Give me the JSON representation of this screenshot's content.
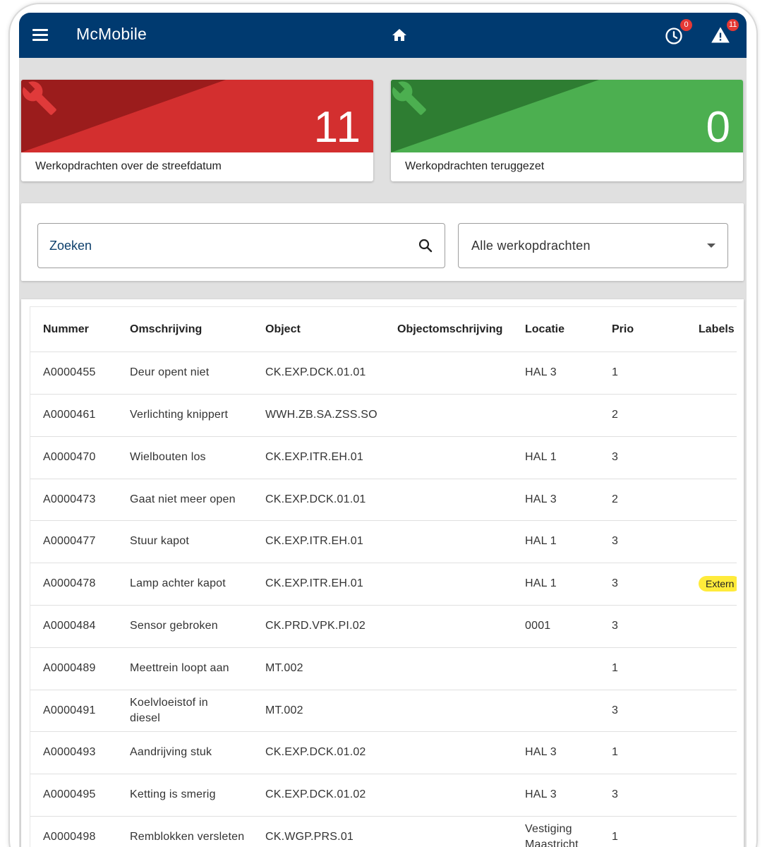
{
  "app": {
    "title": "McMobile",
    "clock_badge": "0",
    "alert_badge": "11"
  },
  "cards": [
    {
      "count": "11",
      "label": "Werkopdrachten over de streefdatum",
      "color": "#d32f2f",
      "dark_color": "#9b1c1c"
    },
    {
      "count": "0",
      "label": "Werkopdrachten teruggezet",
      "color": "#4caf50",
      "dark_color": "#2e7d32"
    }
  ],
  "filters": {
    "search_placeholder": "Zoeken",
    "select_value": "Alle werkopdrachten"
  },
  "table": {
    "headers": {
      "nummer": "Nummer",
      "omschrijving": "Omschrijving",
      "object": "Object",
      "objectomschrijving": "Objectomschrijving",
      "locatie": "Locatie",
      "prio": "Prio",
      "labels": "Labels"
    },
    "rows": [
      {
        "nummer": "A0000455",
        "omschrijving": "Deur opent niet",
        "object": "CK.EXP.DCK.01.01",
        "objectomschrijving": "",
        "locatie": "HAL 3",
        "prio": "1",
        "labels": ""
      },
      {
        "nummer": "A0000461",
        "omschrijving": "Verlichting knippert",
        "object": "WWH.ZB.SA.ZSS.SO",
        "objectomschrijving": "",
        "locatie": "",
        "prio": "2",
        "labels": ""
      },
      {
        "nummer": "A0000470",
        "omschrijving": "Wielbouten los",
        "object": "CK.EXP.ITR.EH.01",
        "objectomschrijving": "",
        "locatie": "HAL 1",
        "prio": "3",
        "labels": ""
      },
      {
        "nummer": "A0000473",
        "omschrijving": "Gaat niet meer open",
        "object": "CK.EXP.DCK.01.01",
        "objectomschrijving": "",
        "locatie": "HAL 3",
        "prio": "2",
        "labels": ""
      },
      {
        "nummer": "A0000477",
        "omschrijving": "Stuur kapot",
        "object": "CK.EXP.ITR.EH.01",
        "objectomschrijving": "",
        "locatie": "HAL 1",
        "prio": "3",
        "labels": ""
      },
      {
        "nummer": "A0000478",
        "omschrijving": "Lamp achter kapot",
        "object": "CK.EXP.ITR.EH.01",
        "objectomschrijving": "",
        "locatie": "HAL 1",
        "prio": "3",
        "labels": "Extern"
      },
      {
        "nummer": "A0000484",
        "omschrijving": "Sensor gebroken",
        "object": "CK.PRD.VPK.PI.02",
        "objectomschrijving": "",
        "locatie": "0001",
        "prio": "3",
        "labels": ""
      },
      {
        "nummer": "A0000489",
        "omschrijving": "Meettrein loopt aan",
        "object": "MT.002",
        "objectomschrijving": "",
        "locatie": "",
        "prio": "1",
        "labels": ""
      },
      {
        "nummer": "A0000491",
        "omschrijving": "Koelvloeistof in diesel",
        "object": "MT.002",
        "objectomschrijving": "",
        "locatie": "",
        "prio": "3",
        "labels": ""
      },
      {
        "nummer": "A0000493",
        "omschrijving": "Aandrijving stuk",
        "object": "CK.EXP.DCK.01.02",
        "objectomschrijving": "",
        "locatie": "HAL 3",
        "prio": "1",
        "labels": ""
      },
      {
        "nummer": "A0000495",
        "omschrijving": "Ketting is smerig",
        "object": "CK.EXP.DCK.01.02",
        "objectomschrijving": "",
        "locatie": "HAL 3",
        "prio": "3",
        "labels": ""
      },
      {
        "nummer": "A0000498",
        "omschrijving": "Remblokken versleten",
        "object": "CK.WGP.PRS.01",
        "objectomschrijving": "",
        "locatie": "Vestiging Maastricht",
        "prio": "1",
        "labels": ""
      }
    ]
  }
}
